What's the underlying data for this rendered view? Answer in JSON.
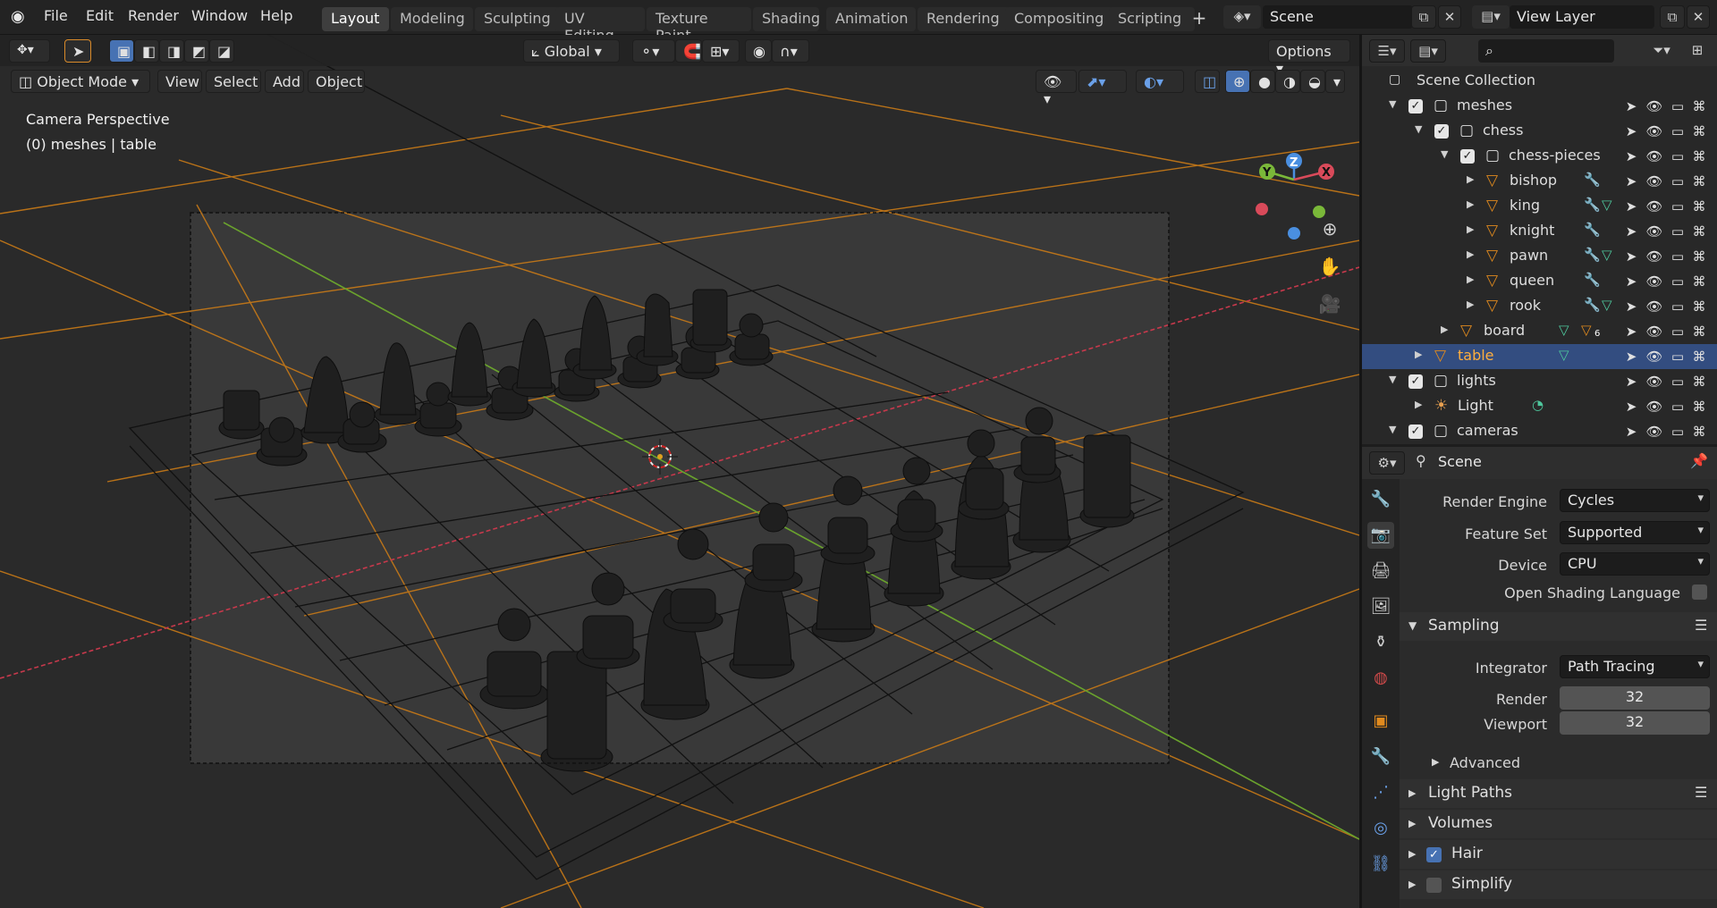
{
  "topbar": {
    "menus": [
      "File",
      "Edit",
      "Render",
      "Window",
      "Help"
    ],
    "workspaces": [
      "Layout",
      "Modeling",
      "Sculpting",
      "UV Editing",
      "Texture Paint",
      "Shading",
      "Animation",
      "Rendering",
      "Compositing",
      "Scripting"
    ],
    "add_workspace": "+",
    "scene_name": "Scene",
    "view_layer_name": "View Layer"
  },
  "toolbar": {
    "transform_orientation": "Global",
    "options_label": "Options"
  },
  "viewport_header": {
    "mode": "Object Mode",
    "menus": [
      "View",
      "Select",
      "Add",
      "Object"
    ]
  },
  "viewport": {
    "view_name": "Camera Perspective",
    "context_info": "(0) meshes | table",
    "gizmo_labels": {
      "z": "Z",
      "y": "Y",
      "x": "X"
    },
    "colors": {
      "x_axis": "#d94a5a",
      "y_axis": "#7ab839",
      "z_axis": "#4a8fe0",
      "selection": "#e08a1e",
      "background": "#3a3a3a",
      "pieces": "#1f1f1f"
    }
  },
  "outliner": {
    "title": "Scene Collection",
    "rows": [
      {
        "label": "meshes",
        "depth": 0,
        "type": "collection",
        "checked": true,
        "expanded": true
      },
      {
        "label": "chess",
        "depth": 1,
        "type": "collection",
        "checked": true,
        "expanded": true
      },
      {
        "label": "chess-pieces",
        "depth": 2,
        "type": "collection",
        "checked": true,
        "expanded": true
      },
      {
        "label": "bishop",
        "depth": 3,
        "type": "mesh",
        "extra": "wrench"
      },
      {
        "label": "king",
        "depth": 3,
        "type": "mesh",
        "extra": "wrench+data"
      },
      {
        "label": "knight",
        "depth": 3,
        "type": "mesh",
        "extra": "wrench"
      },
      {
        "label": "pawn",
        "depth": 3,
        "type": "mesh",
        "extra": "wrench+data"
      },
      {
        "label": "queen",
        "depth": 3,
        "type": "mesh",
        "extra": "wrench"
      },
      {
        "label": "rook",
        "depth": 3,
        "type": "mesh",
        "extra": "wrench+data"
      },
      {
        "label": "board",
        "depth": 2,
        "type": "mesh",
        "extra": "data+6"
      },
      {
        "label": "table",
        "depth": 1,
        "type": "mesh",
        "extra": "data",
        "selected": true
      },
      {
        "label": "lights",
        "depth": 0,
        "type": "collection",
        "checked": true,
        "expanded": true
      },
      {
        "label": "Light",
        "depth": 1,
        "type": "light",
        "extra": "light-data"
      },
      {
        "label": "cameras",
        "depth": 0,
        "type": "collection",
        "checked": true,
        "expanded": true
      }
    ],
    "board_badge": "6"
  },
  "properties": {
    "context_name": "Scene",
    "render_engine": {
      "label": "Render Engine",
      "value": "Cycles"
    },
    "feature_set": {
      "label": "Feature Set",
      "value": "Supported"
    },
    "device": {
      "label": "Device",
      "value": "CPU"
    },
    "osl": {
      "label": "Open Shading Language",
      "checked": false
    },
    "sampling": {
      "title": "Sampling",
      "integrator_label": "Integrator",
      "integrator": "Path Tracing",
      "render_label": "Render",
      "render": "32",
      "viewport_label": "Viewport",
      "viewport": "32",
      "advanced": "Advanced"
    },
    "panels": [
      {
        "title": "Light Paths"
      },
      {
        "title": "Volumes"
      },
      {
        "title": "Hair",
        "checkbox": true,
        "checked": true
      },
      {
        "title": "Simplify",
        "checkbox": true,
        "checked": false
      }
    ]
  }
}
